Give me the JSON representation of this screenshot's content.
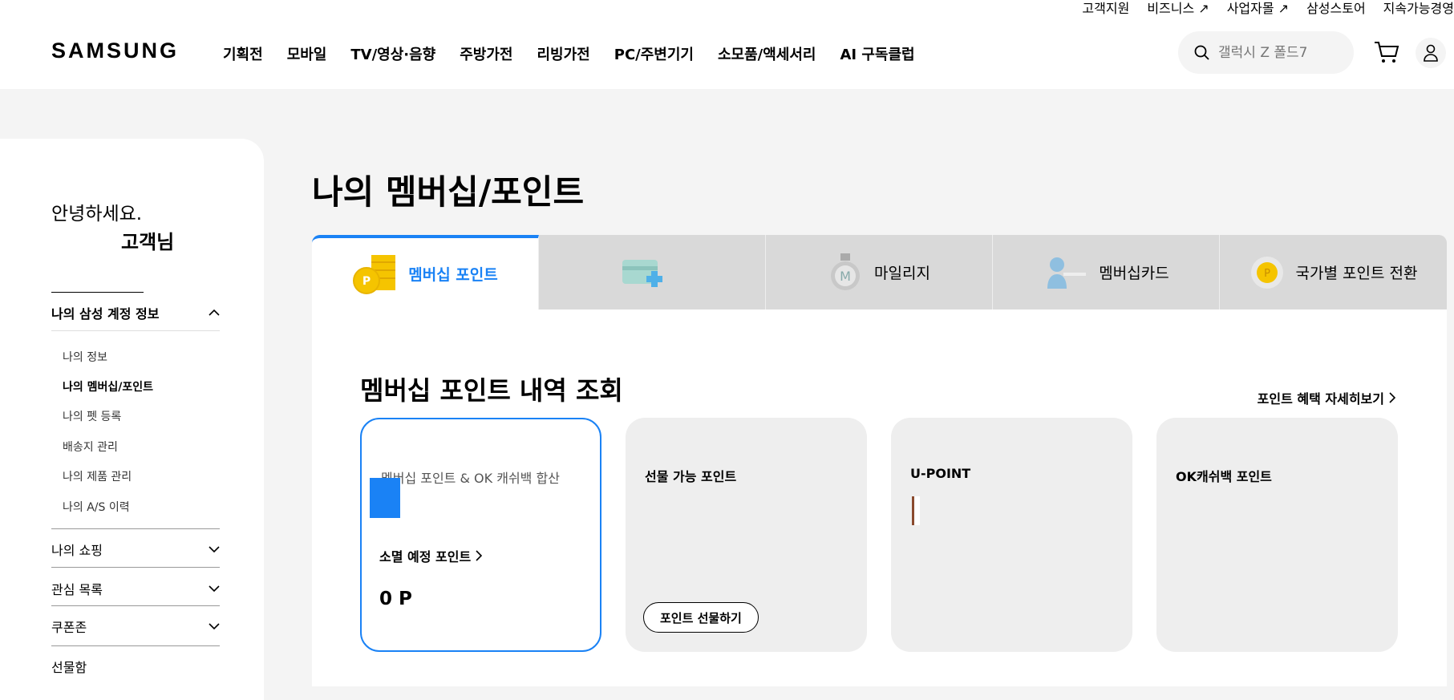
{
  "header": {
    "util_links": [
      "고객지원",
      "비즈니스 ↗",
      "사업자몰 ↗",
      "삼성스토어",
      "지속가능경영"
    ],
    "logo": "SAMSUNG",
    "nav": [
      "기획전",
      "모바일",
      "TV/영상·음향",
      "주방가전",
      "리빙가전",
      "PC/주변기기",
      "소모품/액세서리",
      "AI 구독클럽"
    ],
    "search_placeholder": "갤럭시 Z 폴드7"
  },
  "sidebar": {
    "greeting": "안녕하세요.",
    "name": "고객님",
    "account_section": "나의 삼성 계정 정보",
    "account_items": [
      "나의 정보",
      "나의 멤버십/포인트",
      "나의 펫 등록",
      "배송지 관리",
      "나의 제품 관리",
      "나의 A/S 이력"
    ],
    "sections": [
      "나의 쇼핑",
      "관심 목록",
      "쿠폰존",
      "선물함"
    ]
  },
  "main": {
    "title": "나의 멤버십/포인트",
    "tabs": [
      "멤버십 포인트",
      "",
      "마일리지",
      "멤버십카드",
      "국가별 포인트 전환"
    ],
    "section_title": "멤버십 포인트 내역 조회",
    "more_link": "포인트 혜택 자세히보기",
    "cards": [
      {
        "label": "멤버십 포인트 & OK 캐쉬백 합산"
      },
      {
        "label": "선물 가능 포인트"
      },
      {
        "label": "U-POINT"
      },
      {
        "label": "OK캐쉬백 포인트"
      }
    ],
    "expire_label": "소멸 예정 포인트",
    "expire_value": "0 P",
    "gift_button": "포인트 선물하기"
  },
  "colors": {
    "accent": "#1a82f5",
    "coin": "#f5c400"
  }
}
